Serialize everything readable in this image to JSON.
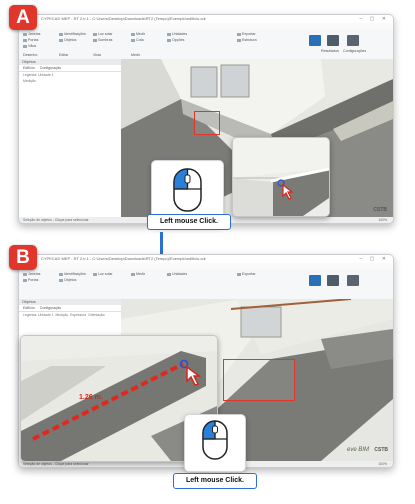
{
  "steps": {
    "a": {
      "badge": "A",
      "caption": "Left mouse Click."
    },
    "b": {
      "badge": "B",
      "caption": "Left mouse Click."
    }
  },
  "window": {
    "title": "CYPECAD MEP - RT 2.b.1 - C:\\Users\\Desktop\\Downloads\\RT2 (Tempo)\\Exemplo\\edificio.cdr",
    "menu": [
      "Ficheiro",
      "Ver",
      "Ajuda"
    ],
    "ribbon": {
      "groups": [
        "Desenho",
        "Editar",
        "Vista",
        "Identificar",
        "Medir",
        "Calcular",
        "Cotas"
      ],
      "items_a": [
        "Janelas",
        "Portas",
        "Vãos",
        "Identificações",
        "Objetos",
        "Luz solar",
        "Sombras",
        "Medir",
        "Cota",
        "Unidades",
        "Opções",
        "Exportar",
        "Estrutura"
      ],
      "big_buttons": [
        "Resultados",
        "Configurações"
      ]
    },
    "side_panel": {
      "header": "Objetos",
      "tabs": [
        "Edifício",
        "Configuração"
      ],
      "rows": [
        "Legenda: Unidade 1",
        "Medição",
        "Espessura",
        "Orientação"
      ]
    },
    "status": "Seleção de objetos - Clique para selecionar",
    "zoom_level": "100%"
  },
  "measurement": {
    "label": "1.26 m."
  },
  "branding": {
    "logo_a": "CSTB",
    "logo_b": "eve BIM",
    "logo_b2": "CSTB"
  },
  "colors": {
    "highlight": "#e0362b",
    "accent": "#2b6fd6",
    "mouse_button": "#2a7fd6"
  }
}
